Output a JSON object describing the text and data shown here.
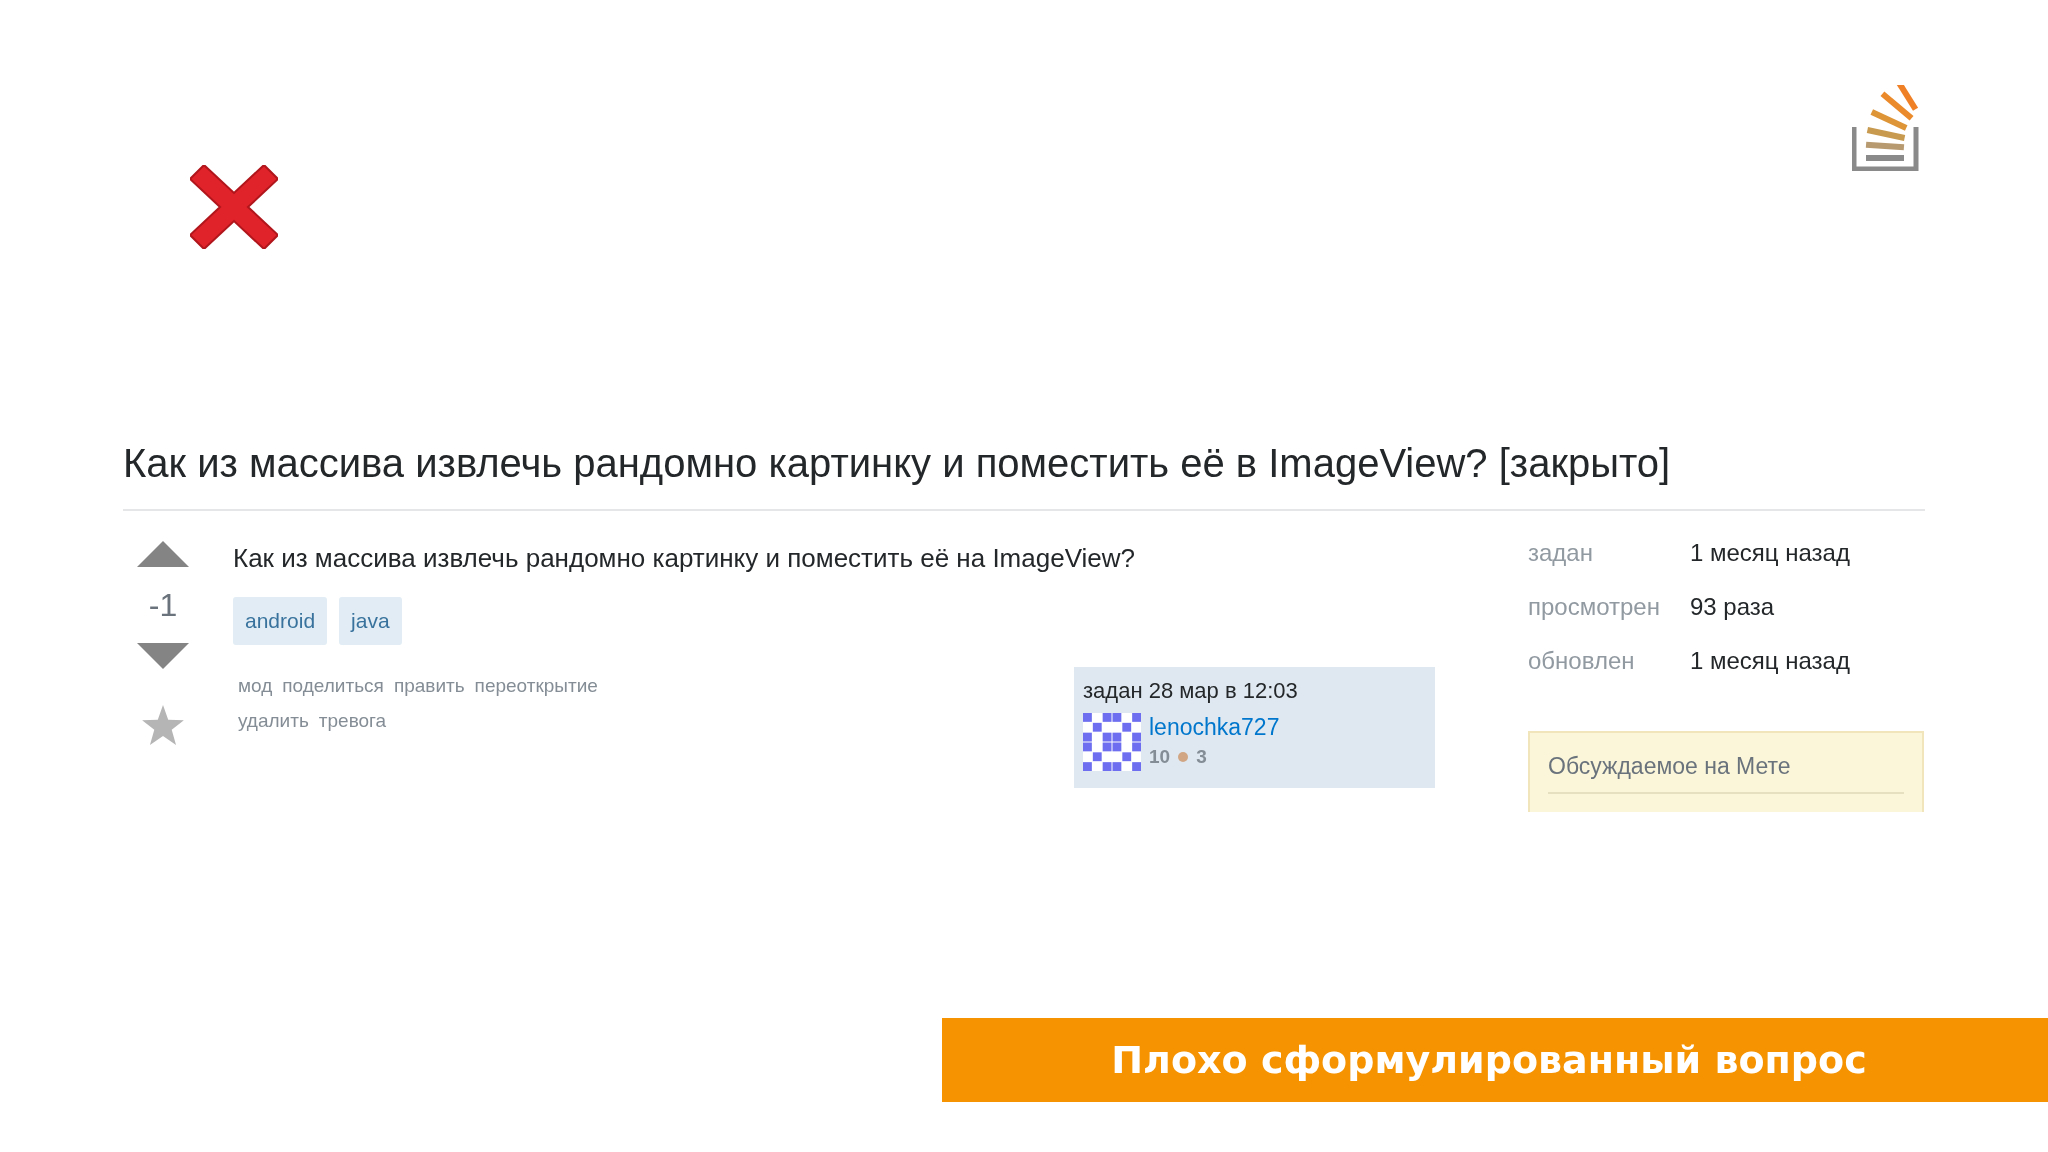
{
  "title": "Как из массива извлечь рандомно картинку и поместить её в ImageView? [закрыто]",
  "question": {
    "score": "-1",
    "text": "Как из массива извлечь рандомно картинку и поместить её на ImageView?",
    "tags": [
      "android",
      "java"
    ],
    "action_rows": [
      {
        "links": [
          "мод",
          "поделиться",
          "править",
          "переоткрытие"
        ]
      },
      {
        "links": [
          "удалить",
          "тревога"
        ]
      }
    ],
    "asked_card": {
      "asked": "задан 28 мар в 12:03",
      "user": "lenochka727",
      "reputation": "10",
      "badges": [
        {
          "color": "#d1a684",
          "count": "3"
        }
      ]
    }
  },
  "stats": [
    {
      "label": "задан",
      "value": "1 месяц назад"
    },
    {
      "label": "просмотрен",
      "value": "93 раза"
    },
    {
      "label": "обновлен",
      "value": "1 месяц назад"
    }
  ],
  "meta_box": {
    "title": "Обсуждаемое на Мете"
  },
  "banner": "Плохо сформулированный вопрос"
}
